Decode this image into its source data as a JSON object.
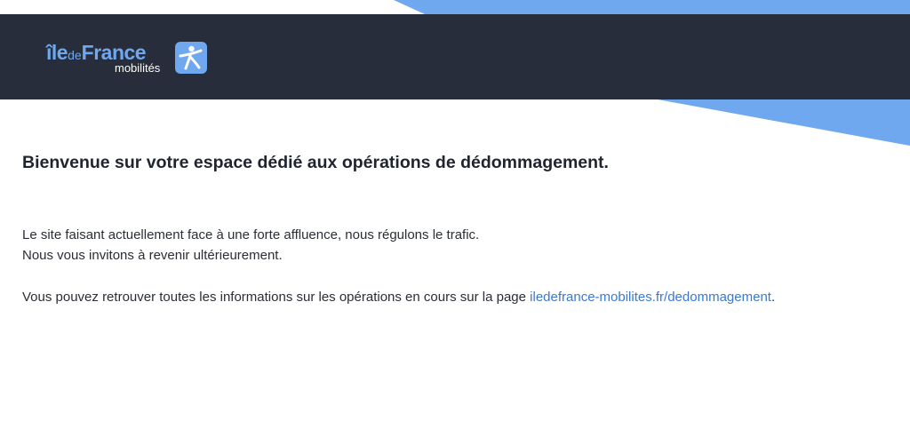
{
  "brand": {
    "logo_ile": "île",
    "logo_de": "de",
    "logo_france": "France",
    "logo_sub": "mobilités"
  },
  "colors": {
    "header_bg": "#272d3a",
    "accent": "#6fa8ee",
    "link": "#3a79d4",
    "text": "#1f2430"
  },
  "main": {
    "title": "Bienvenue sur votre espace dédié aux opérations de dédommagement.",
    "message_line1": "Le site faisant actuellement face à une forte affluence, nous régulons le trafic.",
    "message_line2": "Nous vous invitons à revenir ultérieurement.",
    "info_text": "Vous pouvez retrouver toutes les informations sur les opérations en cours sur la page ",
    "info_link": "iledefrance-mobilites.fr/dedommagement",
    "info_end": "."
  }
}
